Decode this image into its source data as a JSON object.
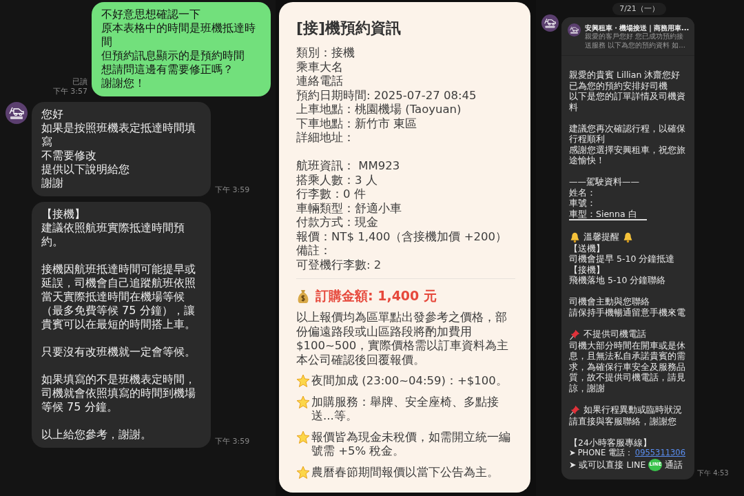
{
  "left_chat": {
    "messages": [
      {
        "kind": "sent",
        "paragraphs": [
          [
            "不好意思想確認一下",
            "原本表格中的時間是班機抵達時間",
            "但預約訊息顯示的是預約時間",
            "想請問這邊有需要修正嗎？",
            "謝謝您！"
          ]
        ],
        "read_label": "已讀",
        "time": "下午 3:57"
      },
      {
        "kind": "received",
        "avatar": true,
        "paragraphs": [
          [
            "您好",
            "如果是按照班機表定抵達時間填寫",
            "不需要修改",
            "提供以下說明給您",
            "謝謝"
          ]
        ],
        "time": "下午 3:59"
      },
      {
        "kind": "received",
        "avatar": false,
        "paragraphs": [
          [
            "【接機】",
            "建議依照航班實際抵達時間預約。"
          ],
          [
            "接機因航班抵達時間可能提早或延誤，司機會自己追蹤航班依照當天實際抵達時間在機場等候（最多免費等候 75 分鐘），讓貴賓可以在最短的時間搭上車。"
          ],
          [
            "只要沒有改班機就一定會等候。"
          ],
          [
            "如果填寫的不是班機表定時間，司機就會依照填寫的時間到機場等候 75 分鐘。"
          ],
          [
            "以上給您參考，謝謝。"
          ]
        ],
        "time": "下午 3:59"
      }
    ]
  },
  "booking_card": {
    "title": "[接]機預約資訊",
    "details": [
      "類別：接機",
      "乘車大名",
      "連絡電話",
      "預約日期時間: 2025-07-27 08:45",
      "上車地點：桃園機場 (Taoyuan)",
      "下車地點：新竹市 東區",
      "詳細地址："
    ],
    "trip_details": [
      "航班資訊： MM923",
      "搭乘人數：3 人",
      "行李數：0 件",
      "車輛類型：舒適小車",
      "付款方式：現金",
      "報價：NT$ 1,400（含接機加價 +200）",
      "備註：",
      "可登機行李數: 2"
    ],
    "total": "訂購金額: 1,400 元",
    "disclaimer": "以上報價均為區單點出發參考之價格，部份偏遠路段或山區路段將酌加費用 $100~500，實際價格需以訂車資料為主本公司確認後回覆報價。",
    "notes": [
      "夜間加成 (23:00~04:59)：+$100。",
      "加購服務：舉牌、安全座椅、多點接送...等。",
      "報價皆為現金未稅價，如需開立統一編號需 +5% 稅金。",
      "農曆春節期間報價以當下公告為主。"
    ]
  },
  "right_chat": {
    "date": "7/21（一）",
    "preview": {
      "title": "安興租車・機場接送｜商務用車...",
      "text": "親愛的客戶您好 您已成功預約接送服務 以下為您的預約資料 如..."
    },
    "blocks": [
      {
        "kind": "text",
        "lines": [
          "親愛的貴賓 Lillian 沐齋您好",
          "已為您的預約安排好司機",
          "以下是您的訂單詳情及司機資料"
        ]
      },
      {
        "kind": "text",
        "lines": [
          "建議您再次確認行程，以確保行程順利",
          "感謝您選擇安興租車，祝您旅途愉快！"
        ]
      },
      {
        "kind": "driver",
        "heading": "——駕駛資料——",
        "lines": [
          "姓名：",
          "車號：",
          "車型：Sienna 白"
        ]
      },
      {
        "kind": "bell_notice",
        "heading": "溫馨提醒",
        "lines": [
          "【送機】",
          "司機會提早 5-10 分鐘抵達",
          "【接機】",
          "飛機落地 5-10 分鐘聯絡"
        ]
      },
      {
        "kind": "text",
        "lines": [
          "司機會主動與您聯絡",
          "請保持手機暢通留意手機來電"
        ]
      },
      {
        "kind": "pin_notice",
        "heading": "不提供司機電話",
        "lines": [
          "司機大部分時間在開車或是休息，且無法私自承諾貴賓的需求，為確保行車安全及服務品質，故不提供司機電話，請見諒，謝謝"
        ]
      },
      {
        "kind": "pin_notice",
        "heading": "如果行程異動或臨時狀況",
        "lines": [
          "請直接與客服聯絡，謝謝您"
        ]
      },
      {
        "kind": "contact",
        "heading": "【24小時客服專線】",
        "bullet": "➤",
        "phone_label": "PHONE 電話：",
        "phone": "0955311306",
        "line_prefix": "或可以直接 LINE",
        "line_badge": "LINE",
        "line_suffix": "通話"
      }
    ],
    "time": "下午 4:53"
  }
}
